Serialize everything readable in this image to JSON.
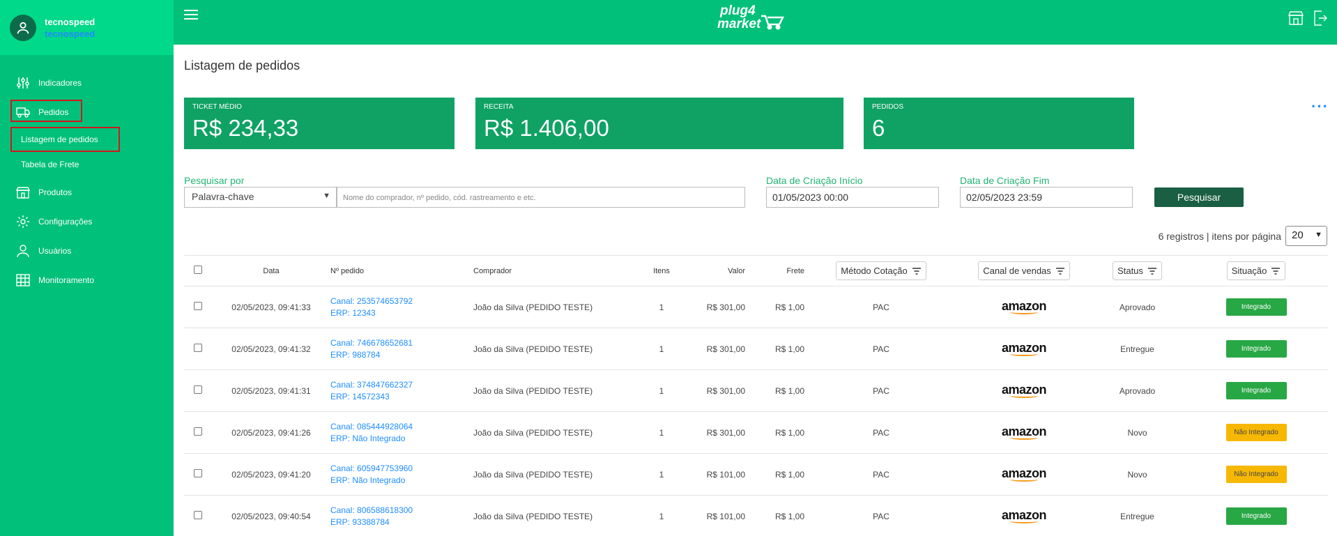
{
  "user": {
    "name": "tecnospeed",
    "company": "tecnospeed"
  },
  "logo": {
    "line1": "plug4",
    "line2": "market"
  },
  "nav": {
    "indicadores": "Indicadores",
    "pedidos": "Pedidos",
    "listagem": "Listagem de pedidos",
    "frete": "Tabela de Frete",
    "produtos": "Produtos",
    "configuracoes": "Configurações",
    "usuarios": "Usuários",
    "monitoramento": "Monitoramento"
  },
  "page": {
    "title": "Listagem de pedidos"
  },
  "cards": [
    {
      "label": "Ticket Médio",
      "value": "R$ 234,33"
    },
    {
      "label": "Receita",
      "value": "R$ 1.406,00"
    },
    {
      "label": "Pedidos",
      "value": "6"
    }
  ],
  "filters": {
    "search_label": "Pesquisar por",
    "search_type": "Palavra-chave",
    "search_placeholder": "Nome do comprador, nº pedido, cód. rastreamento e etc.",
    "date_start_label": "Data de Criação Início",
    "date_start": "01/05/2023  00:00",
    "date_end_label": "Data de Criação Fim",
    "date_end": "02/05/2023  23:59",
    "search_button": "Pesquisar"
  },
  "pagination": {
    "records_text": "6 registros | itens por página",
    "per_page": "20"
  },
  "table": {
    "headers": {
      "data": "Data",
      "pedido": "Nº pedido",
      "comprador": "Comprador",
      "itens": "Itens",
      "valor": "Valor",
      "frete": "Frete",
      "metodo": "Método Cotação",
      "canal": "Canal de vendas",
      "status": "Status",
      "situacao": "Situação"
    },
    "rows": [
      {
        "date": "02/05/2023, 09:41:33",
        "canal": "Canal: 253574653792",
        "erp": "ERP: 12343",
        "buyer": "João da Silva (PEDIDO TESTE)",
        "items": "1",
        "value": "R$ 301,00",
        "freight": "R$ 1,00",
        "method": "PAC",
        "channel": "amazon",
        "status": "Aprovado",
        "situation": "Integrado",
        "situation_kind": "ok"
      },
      {
        "date": "02/05/2023, 09:41:32",
        "canal": "Canal: 746678652681",
        "erp": "ERP: 988784",
        "buyer": "João da Silva (PEDIDO TESTE)",
        "items": "1",
        "value": "R$ 301,00",
        "freight": "R$ 1,00",
        "method": "PAC",
        "channel": "amazon",
        "status": "Entregue",
        "situation": "Integrado",
        "situation_kind": "ok"
      },
      {
        "date": "02/05/2023, 09:41:31",
        "canal": "Canal: 374847662327",
        "erp": "ERP: 14572343",
        "buyer": "João da Silva (PEDIDO TESTE)",
        "items": "1",
        "value": "R$ 301,00",
        "freight": "R$ 1,00",
        "method": "PAC",
        "channel": "amazon",
        "status": "Aprovado",
        "situation": "Integrado",
        "situation_kind": "ok"
      },
      {
        "date": "02/05/2023, 09:41:26",
        "canal": "Canal: 085444928064",
        "erp": "ERP: Não Integrado",
        "buyer": "João da Silva (PEDIDO TESTE)",
        "items": "1",
        "value": "R$ 301,00",
        "freight": "R$ 1,00",
        "method": "PAC",
        "channel": "amazon",
        "status": "Novo",
        "situation": "Não Integrado",
        "situation_kind": "no"
      },
      {
        "date": "02/05/2023, 09:41:20",
        "canal": "Canal: 605947753960",
        "erp": "ERP: Não Integrado",
        "buyer": "João da Silva (PEDIDO TESTE)",
        "items": "1",
        "value": "R$ 101,00",
        "freight": "R$ 1,00",
        "method": "PAC",
        "channel": "amazon",
        "status": "Novo",
        "situation": "Não Integrado",
        "situation_kind": "no"
      },
      {
        "date": "02/05/2023, 09:40:54",
        "canal": "Canal: 806588618300",
        "erp": "ERP: 93388784",
        "buyer": "João da Silva (PEDIDO TESTE)",
        "items": "1",
        "value": "R$ 101,00",
        "freight": "R$ 1,00",
        "method": "PAC",
        "channel": "amazon",
        "status": "Entregue",
        "situation": "Integrado",
        "situation_kind": "ok"
      }
    ]
  },
  "colors": {
    "brand": "#00c07a",
    "card": "#0fa264",
    "link": "#1e8dff",
    "ok": "#28a745",
    "warn": "#f7b804"
  }
}
